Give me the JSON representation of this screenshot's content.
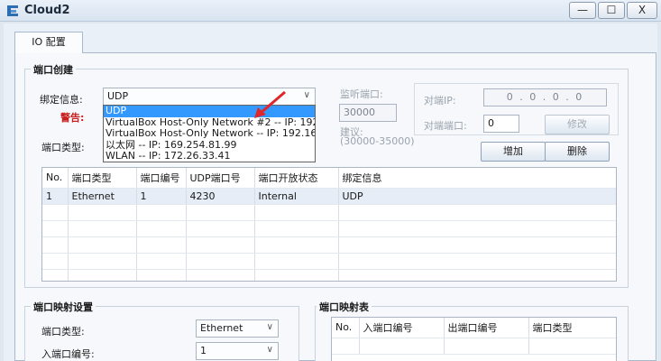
{
  "window": {
    "title": "Cloud2",
    "minimize_glyph": "—",
    "maximize_glyph": "☐",
    "close_glyph": "X"
  },
  "tabs": [
    {
      "label": "IO 配置"
    }
  ],
  "port_create": {
    "title": "端口创建",
    "binding_label": "绑定信息:",
    "binding_value": "UDP",
    "warning_label": "警告:",
    "port_type_label": "端口类型:",
    "dropdown_options": [
      "UDP",
      "VirtualBox Host-Only Network #2 -- IP: 192.168.10",
      "VirtualBox Host-Only Network -- IP: 192.168.56.1",
      "以太网 -- IP: 169.254.81.99",
      "WLAN -- IP: 172.26.33.41"
    ],
    "listen_port_label": "监听端口:",
    "listen_port_value": "30000",
    "suggest_label": "建议:",
    "suggest_range": "(30000-35000)",
    "peer_ip_label": "对端IP:",
    "peer_ip_value": "0 . 0 . 0 . 0",
    "peer_port_label": "对端端口:",
    "peer_port_value": "0",
    "modify_label": "修改",
    "add_label": "增加",
    "delete_label": "删除",
    "table": {
      "columns": [
        "No.",
        "端口类型",
        "端口编号",
        "UDP端口号",
        "端口开放状态",
        "绑定信息"
      ],
      "rows": [
        [
          "1",
          "Ethernet",
          "1",
          "4230",
          "Internal",
          "UDP"
        ]
      ]
    }
  },
  "port_mapping_settings": {
    "title": "端口映射设置",
    "port_type_label": "端口类型:",
    "port_type_value": "Ethernet",
    "in_port_label": "入端口编号:",
    "in_port_value": "1"
  },
  "port_mapping_table": {
    "title": "端口映射表",
    "columns": [
      "No.",
      "入端口编号",
      "出端口编号",
      "端口类型"
    ]
  },
  "colors": {
    "selection": "#3399ff",
    "warning": "#c81e1e",
    "arrow": "#e0262a"
  },
  "icons": {
    "app": "cloud-icon",
    "chevron": "chevron-down-icon"
  }
}
